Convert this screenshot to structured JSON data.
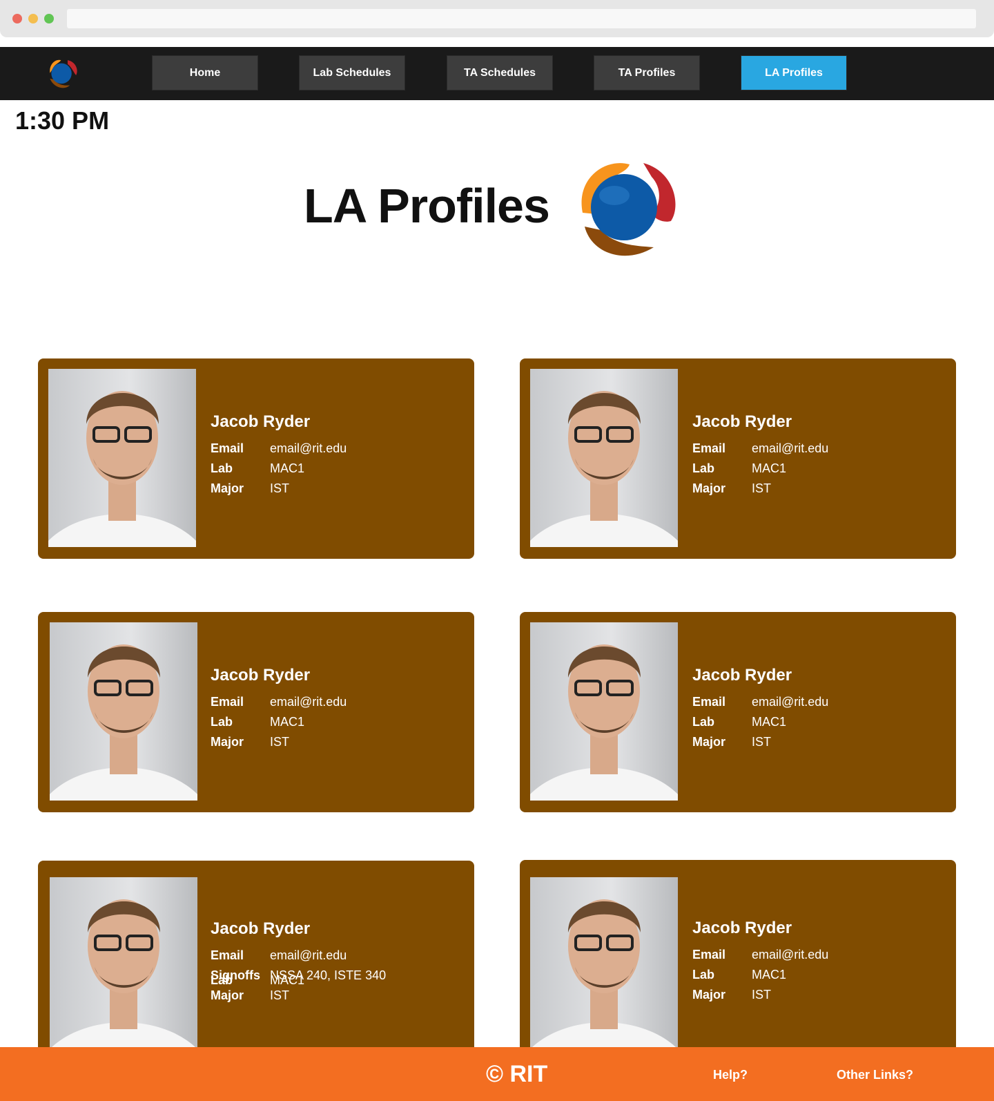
{
  "nav": {
    "items": [
      {
        "label": "Home"
      },
      {
        "label": "Lab Schedules"
      },
      {
        "label": "TA Schedules"
      },
      {
        "label": "TA Profiles"
      },
      {
        "label": "LA Profiles"
      }
    ],
    "active_index": 4
  },
  "clock": {
    "time": "1:30 PM"
  },
  "header": {
    "title": "LA Profiles",
    "logo": "globe-swirl-logo-icon"
  },
  "cards": [
    {
      "name": "Jacob Ryder",
      "rows": [
        {
          "label": "Email",
          "value": "email@rit.edu"
        },
        {
          "label": "Lab",
          "value": "MAC1"
        },
        {
          "label": "Major",
          "value": "IST"
        }
      ]
    },
    {
      "name": "Jacob Ryder",
      "rows": [
        {
          "label": "Email",
          "value": "email@rit.edu"
        },
        {
          "label": "Lab",
          "value": "MAC1"
        },
        {
          "label": "Major",
          "value": "IST"
        }
      ]
    },
    {
      "name": "Jacob Ryder",
      "rows": [
        {
          "label": "Email",
          "value": "email@rit.edu"
        },
        {
          "label": "Lab",
          "value": "MAC1"
        },
        {
          "label": "Major",
          "value": "IST"
        }
      ]
    },
    {
      "name": "Jacob Ryder",
      "rows": [
        {
          "label": "Email",
          "value": "email@rit.edu"
        },
        {
          "label": "Lab",
          "value": "MAC1"
        },
        {
          "label": "Major",
          "value": "IST"
        }
      ]
    },
    {
      "name": "Jacob Ryder",
      "rows": [
        {
          "label": "Email",
          "value": "email@rit.edu"
        },
        {
          "label": "Lab",
          "value": "MAC1"
        },
        {
          "label": "Major",
          "value": "IST"
        }
      ],
      "overlay": {
        "label": "Signoffs",
        "value": "NSSA 240, ISTE 340"
      }
    },
    {
      "name": "Jacob Ryder",
      "rows": [
        {
          "label": "Email",
          "value": "email@rit.edu"
        },
        {
          "label": "Lab",
          "value": "MAC1"
        },
        {
          "label": "Major",
          "value": "IST"
        }
      ]
    }
  ],
  "footer": {
    "copyright": "© RIT",
    "help": "Help?",
    "other": "Other Links?"
  },
  "colors": {
    "nav_bg": "#1a1a1a",
    "nav_active": "#29a7e1",
    "card_bg": "#804c00",
    "footer_bg": "#f36e21"
  }
}
